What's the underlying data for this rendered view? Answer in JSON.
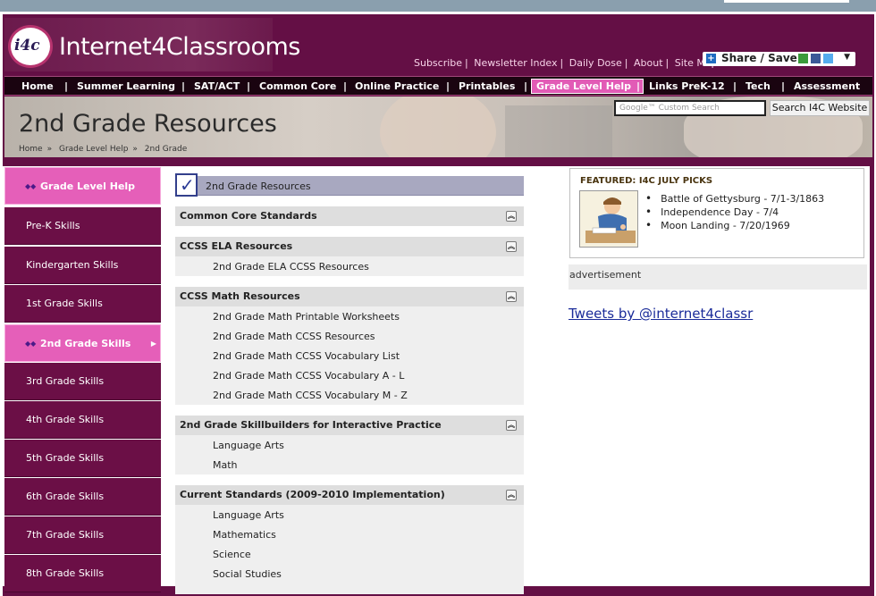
{
  "site": {
    "logo_mark": "i4c",
    "name": "Internet4Classrooms"
  },
  "top_links": [
    "Subscribe",
    "Newsletter Index",
    "Daily Dose",
    "About",
    "Site Map"
  ],
  "share": {
    "label": "Share / Save"
  },
  "nav": {
    "items": [
      "Home",
      "Summer Learning",
      "SAT/ACT",
      "Common Core",
      "Online Practice",
      "Printables",
      "Grade Level Help",
      "Links PreK-12",
      "Tech",
      "Assessment"
    ],
    "active": "Grade Level Help"
  },
  "banner": {
    "title": "2nd Grade Resources",
    "breadcrumb": [
      "Home",
      "Grade Level Help",
      "2nd Grade"
    ],
    "search_placeholder": "Google™ Custom Search",
    "search_button": "Search I4C Website"
  },
  "sidebar": {
    "items": [
      "Grade Level Help",
      "Pre-K Skills",
      "Kindergarten Skills",
      "1st Grade Skills",
      "2nd Grade Skills",
      "3rd Grade Skills",
      "4th Grade Skills",
      "5th Grade Skills",
      "6th Grade Skills",
      "7th Grade Skills",
      "8th Grade Skills"
    ],
    "highlighted": [
      "Grade Level Help",
      "2nd Grade Skills"
    ]
  },
  "main": {
    "title": "2nd Grade Resources",
    "sections": [
      {
        "heading": "Common Core Standards",
        "links": []
      },
      {
        "heading": "CCSS ELA Resources",
        "links": [
          "2nd Grade ELA CCSS Resources"
        ]
      },
      {
        "heading": "CCSS Math Resources",
        "links": [
          "2nd Grade Math Printable Worksheets",
          "2nd Grade Math CCSS Resources",
          "2nd Grade Math CCSS Vocabulary List",
          "2nd Grade Math CCSS Vocabulary A - L",
          "2nd Grade Math CCSS Vocabulary M - Z"
        ]
      },
      {
        "heading": "2nd Grade Skillbuilders for Interactive Practice",
        "links": [
          "Language Arts",
          "Math"
        ]
      },
      {
        "heading": "Current Standards (2009-2010 Implementation)",
        "links": [
          "Language Arts",
          "Mathematics",
          "Science",
          "Social Studies"
        ]
      }
    ]
  },
  "featured": {
    "title": "FEATURED: I4C JULY PICKS",
    "items": [
      "Battle of Gettysburg - 7/1-3/1863",
      "Independence Day - 7/4",
      "Moon Landing - 7/20/1969"
    ]
  },
  "ad": {
    "label": "advertisement"
  },
  "tweets": {
    "label": "Tweets by @internet4classr"
  },
  "colors": {
    "brand": "#640f45",
    "highlight": "#e55fb9",
    "nav_bg": "#1a0410"
  }
}
